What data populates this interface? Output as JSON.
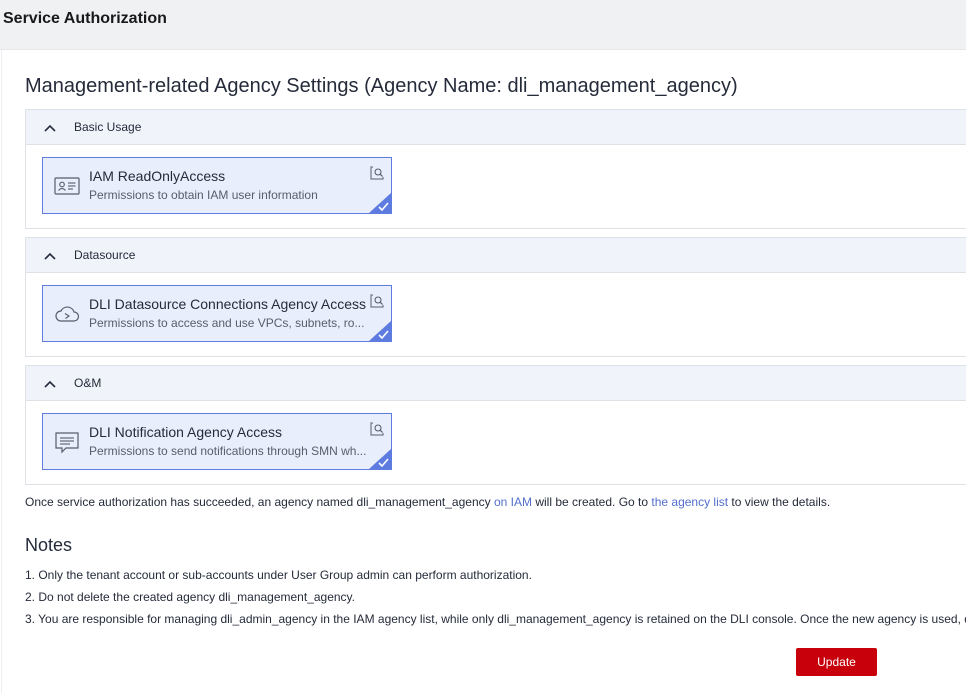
{
  "header": {
    "title": "Service Authorization"
  },
  "heading": "Management-related Agency Settings (Agency Name: dli_management_agency)",
  "groups": [
    {
      "label": "Basic Usage",
      "card": {
        "icon": "id-card-icon",
        "title": "IAM ReadOnlyAccess",
        "desc": "Permissions to obtain IAM user information",
        "selected": true
      }
    },
    {
      "label": "Datasource",
      "card": {
        "icon": "cloud-icon",
        "title": "DLI Datasource Connections Agency Access",
        "desc": "Permissions to access and use VPCs, subnets, ro...",
        "selected": true
      }
    },
    {
      "label": "O&M",
      "card": {
        "icon": "message-icon",
        "title": "DLI Notification Agency Access",
        "desc": "Permissions to send notifications through SMN wh...",
        "selected": true
      }
    }
  ],
  "info": {
    "prefix": "Once service authorization has succeeded, an agency named dli_management_agency ",
    "link_iam": "on IAM",
    "middle": " will be created. Go to ",
    "link_list": "the agency list",
    "suffix": " to view the details."
  },
  "notes": {
    "title": "Notes",
    "items": [
      "1. Only the tenant account or sub-accounts under User Group admin can perform authorization.",
      "2. Do not delete the created agency dli_management_agency.",
      "3. You are responsible for managing dli_admin_agency in the IAM agency list, while only dli_management_agency is retained on the DLI console. Once the new agency is used, d"
    ]
  },
  "actions": {
    "update_label": "Update"
  },
  "colors": {
    "accent": "#5e7ce0",
    "card_bg": "#e8eefb",
    "primary_button": "#c7000b",
    "link": "#526ecc"
  }
}
